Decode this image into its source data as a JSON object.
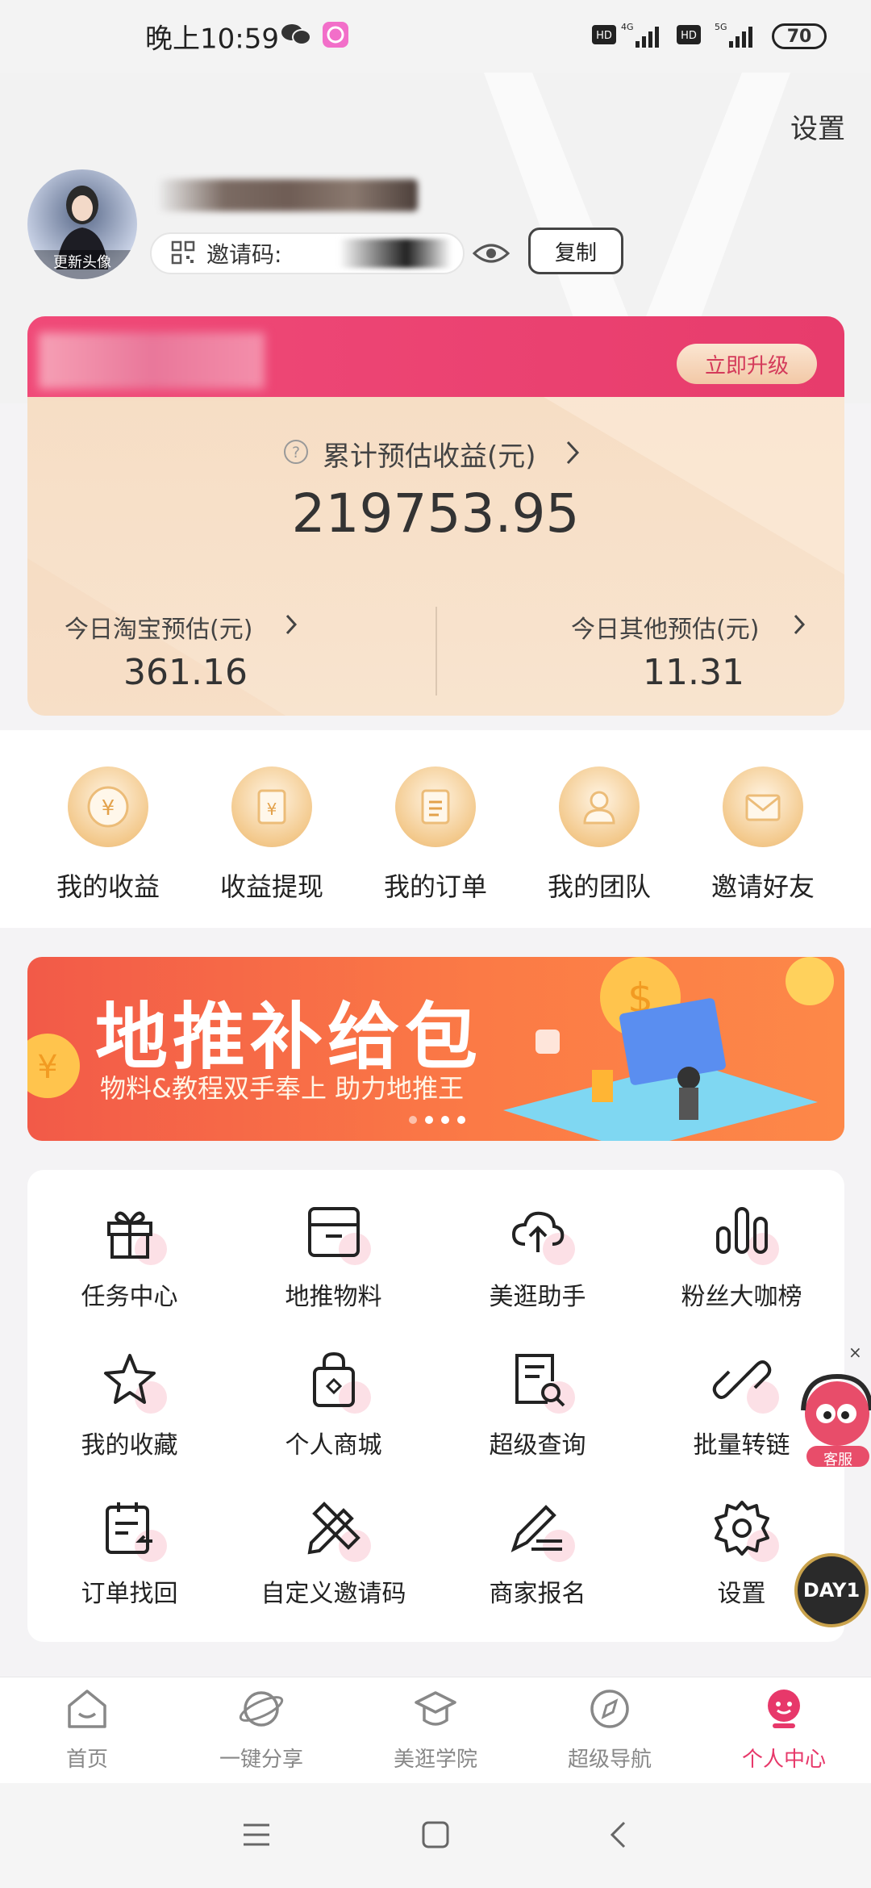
{
  "status_bar": {
    "time": "晚上10:59",
    "icons": [
      "wechat-icon",
      "app-icon",
      "hd-icon",
      "4g-signal-icon",
      "hd-icon",
      "5g-signal-icon"
    ],
    "battery": "70"
  },
  "header": {
    "settings_label": "设置",
    "avatar_label": "更新头像",
    "invite_label": "邀请码:",
    "copy_label": "复制"
  },
  "earnings": {
    "upgrade_label": "立即升级",
    "total_label": "累计预估收益(元)",
    "total_value": "219753.95",
    "taobao_label": "今日淘宝预估(元)",
    "taobao_value": "361.16",
    "other_label": "今日其他预估(元)",
    "other_value": "11.31"
  },
  "quick_actions": [
    {
      "label": "我的收益",
      "icon": "yen-coin-icon"
    },
    {
      "label": "收益提现",
      "icon": "withdraw-icon"
    },
    {
      "label": "我的订单",
      "icon": "order-icon"
    },
    {
      "label": "我的团队",
      "icon": "team-icon"
    },
    {
      "label": "邀请好友",
      "icon": "envelope-icon"
    }
  ],
  "banner": {
    "title": "地推补给包",
    "subtitle": "物料&教程双手奉上 助力地推王",
    "page_count": 4,
    "active_index": 0
  },
  "grid": [
    {
      "label": "任务中心",
      "icon": "gift-icon"
    },
    {
      "label": "地推物料",
      "icon": "box-icon"
    },
    {
      "label": "美逛助手",
      "icon": "cloud-upload-icon"
    },
    {
      "label": "粉丝大咖榜",
      "icon": "bar-chart-icon"
    },
    {
      "label": "我的收藏",
      "icon": "star-icon"
    },
    {
      "label": "个人商城",
      "icon": "shopping-bag-icon"
    },
    {
      "label": "超级查询",
      "icon": "doc-search-icon"
    },
    {
      "label": "批量转链",
      "icon": "link-icon"
    },
    {
      "label": "订单找回",
      "icon": "clipboard-icon"
    },
    {
      "label": "自定义邀请码",
      "icon": "pencil-ruler-icon"
    },
    {
      "label": "商家报名",
      "icon": "pen-icon"
    },
    {
      "label": "设置",
      "icon": "gear-icon"
    }
  ],
  "floating": {
    "cs_label": "客服",
    "close_label": "×",
    "day_label": "DAY1"
  },
  "bottom_nav": [
    {
      "label": "首页",
      "icon": "home-icon",
      "active": false
    },
    {
      "label": "一键分享",
      "icon": "planet-icon",
      "active": false
    },
    {
      "label": "美逛学院",
      "icon": "graduation-cap-icon",
      "active": false
    },
    {
      "label": "超级导航",
      "icon": "compass-icon",
      "active": false
    },
    {
      "label": "个人中心",
      "icon": "profile-icon",
      "active": true
    }
  ],
  "colors": {
    "accent": "#e7386a",
    "card_bg": "#f8e4cf",
    "banner": "#fb7a46"
  }
}
